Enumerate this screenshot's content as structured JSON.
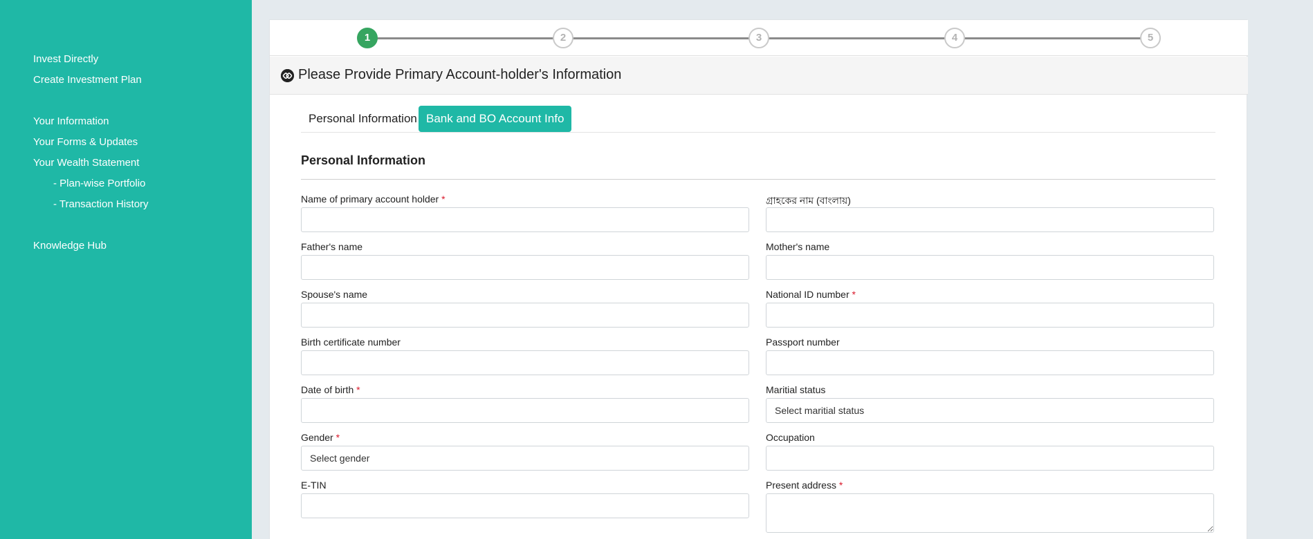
{
  "sidebar": {
    "items": [
      {
        "label": "Invest Directly"
      },
      {
        "label": "Create Investment Plan"
      },
      {
        "label": "Your Information"
      },
      {
        "label": "Your Forms & Updates"
      },
      {
        "label": "Your Wealth Statement"
      },
      {
        "label": "- Plan-wise Portfolio"
      },
      {
        "label": "- Transaction History"
      },
      {
        "label": "Knowledge Hub"
      }
    ]
  },
  "stepper": {
    "current": 1,
    "steps": [
      "1",
      "2",
      "3",
      "4",
      "5"
    ]
  },
  "panel": {
    "title": "Please Provide Primary Account-holder's Information"
  },
  "tabs": [
    "Personal Information",
    "Bank and BO Account Info"
  ],
  "section": {
    "title": "Personal Information"
  },
  "fields": {
    "name": {
      "label": "Name of primary account holder",
      "required": "*",
      "value": ""
    },
    "name_bn": {
      "label": "গ্রাহকের নাম (বাংলায়)",
      "value": ""
    },
    "father": {
      "label": "Father's name",
      "value": ""
    },
    "mother": {
      "label": "Mother's name",
      "value": ""
    },
    "spouse": {
      "label": "Spouse's name",
      "value": ""
    },
    "nid": {
      "label": "National ID number",
      "required": "*",
      "value": ""
    },
    "birth_cert": {
      "label": "Birth certificate number",
      "value": ""
    },
    "passport": {
      "label": "Passport number",
      "value": ""
    },
    "dob": {
      "label": "Date of birth",
      "required": "*",
      "value": ""
    },
    "marital": {
      "label": "Maritial status",
      "selected": "Select maritial status"
    },
    "gender": {
      "label": "Gender",
      "required": "*",
      "selected": "Select gender"
    },
    "occupation": {
      "label": "Occupation",
      "value": ""
    },
    "etin": {
      "label": "E-TIN",
      "value": ""
    },
    "address": {
      "label": "Present address",
      "required": "*",
      "value": ""
    }
  },
  "colors": {
    "sidebar_bg": "#1fb8a6",
    "accent": "#1fb8a6",
    "step_active": "#36a560",
    "required": "#d9192b"
  }
}
